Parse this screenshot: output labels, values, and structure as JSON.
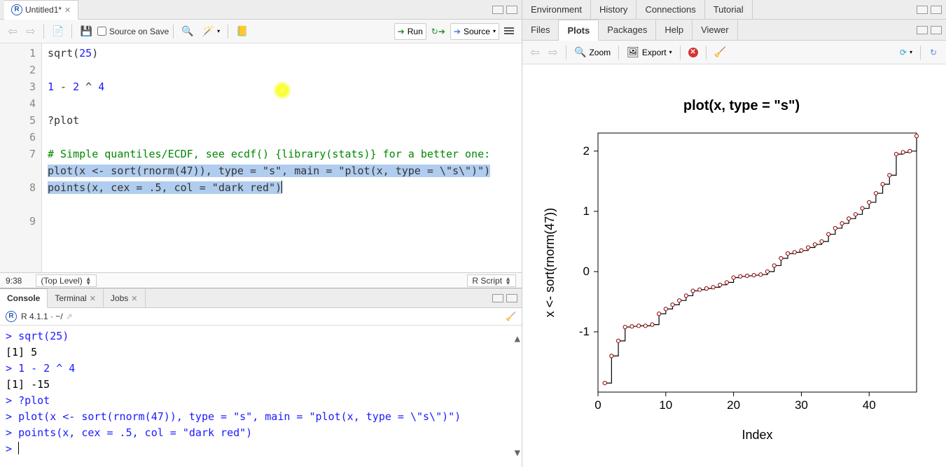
{
  "editor": {
    "tab_title": "Untitled1*",
    "source_on_save_label": "Source on Save",
    "run_label": "Run",
    "source_label": "Source",
    "lines": {
      "l1_num": "1",
      "l1_code": "sqrt(25)",
      "l2_num": "2",
      "l3_num": "3",
      "l3_a": "1",
      "l3_b": " - ",
      "l3_c": "2",
      "l3_d": " ^ ",
      "l3_e": "4",
      "l4_num": "4",
      "l5_num": "5",
      "l5_code": "?plot",
      "l6_num": "6",
      "l7_num": "7",
      "l7_com": "# Simple quantiles/ECDF, see ecdf() {library(stats)} for a better one:",
      "l8_num": "8",
      "l8_code": "plot(x <- sort(rnorm(47)), type = \"s\", main = \"plot(x, type = \\\"s\\\")\")",
      "l9_num": "9",
      "l9_code": "points(x, cex = .5, col = \"dark red\")"
    },
    "status_pos": "9:38",
    "scope": "(Top Level)",
    "lang": "R Script"
  },
  "console": {
    "tabs": {
      "console": "Console",
      "terminal": "Terminal",
      "jobs": "Jobs"
    },
    "version": "R 4.1.1 · ~/",
    "lines": {
      "p1": "> ",
      "c1": "sqrt(25)",
      "o1": "[1] 5",
      "p2": "> ",
      "c2": "1 - 2 ^ 4",
      "o2": "[1] -15",
      "p3": "> ",
      "c3": "?plot",
      "p4": "> ",
      "c4": "plot(x <- sort(rnorm(47)), type = \"s\", main = \"plot(x, type = \\\"s\\\")\")",
      "p5": "> ",
      "c5": "points(x, cex = .5, col = \"dark red\")",
      "p6": "> "
    }
  },
  "right_top": {
    "tabs": {
      "env": "Environment",
      "hist": "History",
      "conn": "Connections",
      "tut": "Tutorial"
    }
  },
  "right_bottom": {
    "tabs": {
      "files": "Files",
      "plots": "Plots",
      "pkg": "Packages",
      "help": "Help",
      "viewer": "Viewer"
    },
    "zoom_label": "Zoom",
    "export_label": "Export"
  },
  "chart_data": {
    "type": "step-scatter",
    "title": "plot(x, type = \"s\")",
    "xlabel": "Index",
    "ylabel": "x <- sort(rnorm(47))",
    "xlim": [
      0,
      47
    ],
    "ylim": [
      -2,
      2.3
    ],
    "xticks": [
      0,
      10,
      20,
      30,
      40
    ],
    "yticks": [
      -1,
      0,
      1,
      2
    ],
    "x": [
      1,
      2,
      3,
      4,
      5,
      6,
      7,
      8,
      9,
      10,
      11,
      12,
      13,
      14,
      15,
      16,
      17,
      18,
      19,
      20,
      21,
      22,
      23,
      24,
      25,
      26,
      27,
      28,
      29,
      30,
      31,
      32,
      33,
      34,
      35,
      36,
      37,
      38,
      39,
      40,
      41,
      42,
      43,
      44,
      45,
      46,
      47
    ],
    "y": [
      -1.85,
      -1.4,
      -1.15,
      -0.92,
      -0.91,
      -0.9,
      -0.9,
      -0.88,
      -0.7,
      -0.62,
      -0.55,
      -0.48,
      -0.4,
      -0.32,
      -0.3,
      -0.28,
      -0.26,
      -0.22,
      -0.18,
      -0.1,
      -0.08,
      -0.07,
      -0.06,
      -0.05,
      0.0,
      0.1,
      0.22,
      0.3,
      0.32,
      0.35,
      0.4,
      0.45,
      0.5,
      0.62,
      0.72,
      0.8,
      0.88,
      0.95,
      1.05,
      1.15,
      1.3,
      1.45,
      1.6,
      1.95,
      1.98,
      2.0,
      2.25
    ],
    "point_color": "#8B0000"
  }
}
